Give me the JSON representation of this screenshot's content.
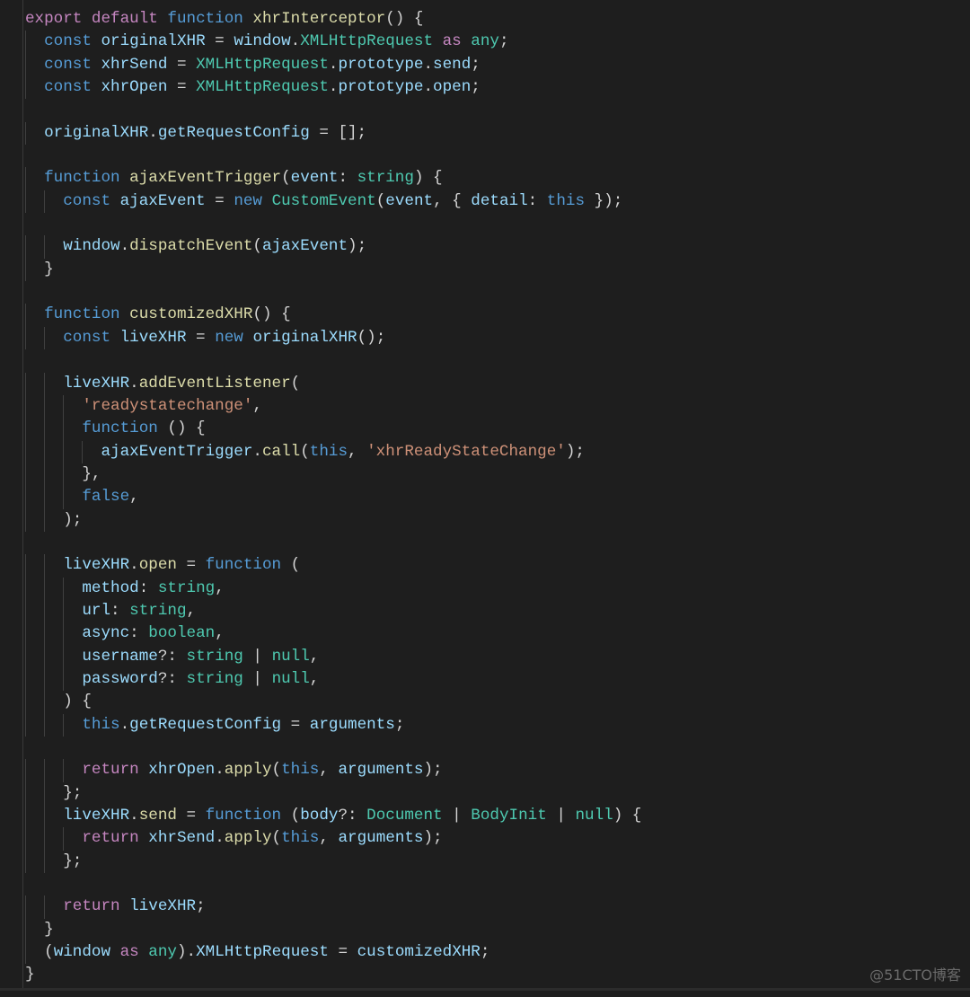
{
  "colors": {
    "background": "#1e1e1e",
    "keyword_control": "#c586c0",
    "keyword": "#569cd6",
    "variable": "#9cdcfe",
    "function": "#dcdcaa",
    "type": "#4ec9b0",
    "string": "#ce9178",
    "punctuation": "#d4d4d4"
  },
  "watermark": "@51CTO博客",
  "lines": [
    [
      [
        "k",
        "export"
      ],
      [
        "p",
        " "
      ],
      [
        "k",
        "default"
      ],
      [
        "p",
        " "
      ],
      [
        "b",
        "function"
      ],
      [
        "p",
        " "
      ],
      [
        "f",
        "xhrInterceptor"
      ],
      [
        "p",
        "() {"
      ]
    ],
    [
      [
        "p",
        "  "
      ],
      [
        "b",
        "const"
      ],
      [
        "p",
        " "
      ],
      [
        "v",
        "originalXHR"
      ],
      [
        "p",
        " = "
      ],
      [
        "v",
        "window"
      ],
      [
        "p",
        "."
      ],
      [
        "t",
        "XMLHttpRequest"
      ],
      [
        "p",
        " "
      ],
      [
        "k",
        "as"
      ],
      [
        "p",
        " "
      ],
      [
        "t",
        "any"
      ],
      [
        "p",
        ";"
      ]
    ],
    [
      [
        "p",
        "  "
      ],
      [
        "b",
        "const"
      ],
      [
        "p",
        " "
      ],
      [
        "v",
        "xhrSend"
      ],
      [
        "p",
        " = "
      ],
      [
        "t",
        "XMLHttpRequest"
      ],
      [
        "p",
        "."
      ],
      [
        "v",
        "prototype"
      ],
      [
        "p",
        "."
      ],
      [
        "v",
        "send"
      ],
      [
        "p",
        ";"
      ]
    ],
    [
      [
        "p",
        "  "
      ],
      [
        "b",
        "const"
      ],
      [
        "p",
        " "
      ],
      [
        "v",
        "xhrOpen"
      ],
      [
        "p",
        " = "
      ],
      [
        "t",
        "XMLHttpRequest"
      ],
      [
        "p",
        "."
      ],
      [
        "v",
        "prototype"
      ],
      [
        "p",
        "."
      ],
      [
        "v",
        "open"
      ],
      [
        "p",
        ";"
      ]
    ],
    [],
    [
      [
        "p",
        "  "
      ],
      [
        "v",
        "originalXHR"
      ],
      [
        "p",
        "."
      ],
      [
        "v",
        "getRequestConfig"
      ],
      [
        "p",
        " = [];"
      ]
    ],
    [],
    [
      [
        "p",
        "  "
      ],
      [
        "b",
        "function"
      ],
      [
        "p",
        " "
      ],
      [
        "f",
        "ajaxEventTrigger"
      ],
      [
        "p",
        "("
      ],
      [
        "v",
        "event"
      ],
      [
        "p",
        ": "
      ],
      [
        "t",
        "string"
      ],
      [
        "p",
        ") {"
      ]
    ],
    [
      [
        "p",
        "    "
      ],
      [
        "b",
        "const"
      ],
      [
        "p",
        " "
      ],
      [
        "v",
        "ajaxEvent"
      ],
      [
        "p",
        " = "
      ],
      [
        "b",
        "new"
      ],
      [
        "p",
        " "
      ],
      [
        "t",
        "CustomEvent"
      ],
      [
        "p",
        "("
      ],
      [
        "v",
        "event"
      ],
      [
        "p",
        ", { "
      ],
      [
        "v",
        "detail"
      ],
      [
        "p",
        ": "
      ],
      [
        "b",
        "this"
      ],
      [
        "p",
        " });"
      ]
    ],
    [],
    [
      [
        "p",
        "    "
      ],
      [
        "v",
        "window"
      ],
      [
        "p",
        "."
      ],
      [
        "f",
        "dispatchEvent"
      ],
      [
        "p",
        "("
      ],
      [
        "v",
        "ajaxEvent"
      ],
      [
        "p",
        ");"
      ]
    ],
    [
      [
        "p",
        "  }"
      ]
    ],
    [],
    [
      [
        "p",
        "  "
      ],
      [
        "b",
        "function"
      ],
      [
        "p",
        " "
      ],
      [
        "f",
        "customizedXHR"
      ],
      [
        "p",
        "() {"
      ]
    ],
    [
      [
        "p",
        "    "
      ],
      [
        "b",
        "const"
      ],
      [
        "p",
        " "
      ],
      [
        "v",
        "liveXHR"
      ],
      [
        "p",
        " = "
      ],
      [
        "b",
        "new"
      ],
      [
        "p",
        " "
      ],
      [
        "v",
        "originalXHR"
      ],
      [
        "p",
        "();"
      ]
    ],
    [],
    [
      [
        "p",
        "    "
      ],
      [
        "v",
        "liveXHR"
      ],
      [
        "p",
        "."
      ],
      [
        "f",
        "addEventListener"
      ],
      [
        "p",
        "("
      ]
    ],
    [
      [
        "p",
        "      "
      ],
      [
        "s",
        "'readystatechange'"
      ],
      [
        "p",
        ","
      ]
    ],
    [
      [
        "p",
        "      "
      ],
      [
        "b",
        "function"
      ],
      [
        "p",
        " () {"
      ]
    ],
    [
      [
        "p",
        "        "
      ],
      [
        "v",
        "ajaxEventTrigger"
      ],
      [
        "p",
        "."
      ],
      [
        "f",
        "call"
      ],
      [
        "p",
        "("
      ],
      [
        "b",
        "this"
      ],
      [
        "p",
        ", "
      ],
      [
        "s",
        "'xhrReadyStateChange'"
      ],
      [
        "p",
        ");"
      ]
    ],
    [
      [
        "p",
        "      },"
      ]
    ],
    [
      [
        "p",
        "      "
      ],
      [
        "b",
        "false"
      ],
      [
        "p",
        ","
      ]
    ],
    [
      [
        "p",
        "    );"
      ]
    ],
    [],
    [
      [
        "p",
        "    "
      ],
      [
        "v",
        "liveXHR"
      ],
      [
        "p",
        "."
      ],
      [
        "f",
        "open"
      ],
      [
        "p",
        " = "
      ],
      [
        "b",
        "function"
      ],
      [
        "p",
        " ("
      ]
    ],
    [
      [
        "p",
        "      "
      ],
      [
        "v",
        "method"
      ],
      [
        "p",
        ": "
      ],
      [
        "t",
        "string"
      ],
      [
        "p",
        ","
      ]
    ],
    [
      [
        "p",
        "      "
      ],
      [
        "v",
        "url"
      ],
      [
        "p",
        ": "
      ],
      [
        "t",
        "string"
      ],
      [
        "p",
        ","
      ]
    ],
    [
      [
        "p",
        "      "
      ],
      [
        "v",
        "async"
      ],
      [
        "p",
        ": "
      ],
      [
        "t",
        "boolean"
      ],
      [
        "p",
        ","
      ]
    ],
    [
      [
        "p",
        "      "
      ],
      [
        "v",
        "username"
      ],
      [
        "p",
        "?: "
      ],
      [
        "t",
        "string"
      ],
      [
        "p",
        " | "
      ],
      [
        "t",
        "null"
      ],
      [
        "p",
        ","
      ]
    ],
    [
      [
        "p",
        "      "
      ],
      [
        "v",
        "password"
      ],
      [
        "p",
        "?: "
      ],
      [
        "t",
        "string"
      ],
      [
        "p",
        " | "
      ],
      [
        "t",
        "null"
      ],
      [
        "p",
        ","
      ]
    ],
    [
      [
        "p",
        "    ) {"
      ]
    ],
    [
      [
        "p",
        "      "
      ],
      [
        "b",
        "this"
      ],
      [
        "p",
        "."
      ],
      [
        "v",
        "getRequestConfig"
      ],
      [
        "p",
        " = "
      ],
      [
        "v",
        "arguments"
      ],
      [
        "p",
        ";"
      ]
    ],
    [],
    [
      [
        "p",
        "      "
      ],
      [
        "k",
        "return"
      ],
      [
        "p",
        " "
      ],
      [
        "v",
        "xhrOpen"
      ],
      [
        "p",
        "."
      ],
      [
        "f",
        "apply"
      ],
      [
        "p",
        "("
      ],
      [
        "b",
        "this"
      ],
      [
        "p",
        ", "
      ],
      [
        "v",
        "arguments"
      ],
      [
        "p",
        ");"
      ]
    ],
    [
      [
        "p",
        "    };"
      ]
    ],
    [
      [
        "p",
        "    "
      ],
      [
        "v",
        "liveXHR"
      ],
      [
        "p",
        "."
      ],
      [
        "f",
        "send"
      ],
      [
        "p",
        " = "
      ],
      [
        "b",
        "function"
      ],
      [
        "p",
        " ("
      ],
      [
        "v",
        "body"
      ],
      [
        "p",
        "?: "
      ],
      [
        "t",
        "Document"
      ],
      [
        "p",
        " | "
      ],
      [
        "t",
        "BodyInit"
      ],
      [
        "p",
        " | "
      ],
      [
        "t",
        "null"
      ],
      [
        "p",
        ") {"
      ]
    ],
    [
      [
        "p",
        "      "
      ],
      [
        "k",
        "return"
      ],
      [
        "p",
        " "
      ],
      [
        "v",
        "xhrSend"
      ],
      [
        "p",
        "."
      ],
      [
        "f",
        "apply"
      ],
      [
        "p",
        "("
      ],
      [
        "b",
        "this"
      ],
      [
        "p",
        ", "
      ],
      [
        "v",
        "arguments"
      ],
      [
        "p",
        ");"
      ]
    ],
    [
      [
        "p",
        "    };"
      ]
    ],
    [],
    [
      [
        "p",
        "    "
      ],
      [
        "k",
        "return"
      ],
      [
        "p",
        " "
      ],
      [
        "v",
        "liveXHR"
      ],
      [
        "p",
        ";"
      ]
    ],
    [
      [
        "p",
        "  }"
      ]
    ],
    [
      [
        "p",
        "  ("
      ],
      [
        "v",
        "window"
      ],
      [
        "p",
        " "
      ],
      [
        "k",
        "as"
      ],
      [
        "p",
        " "
      ],
      [
        "t",
        "any"
      ],
      [
        "p",
        ")."
      ],
      [
        "v",
        "XMLHttpRequest"
      ],
      [
        "p",
        " = "
      ],
      [
        "v",
        "customizedXHR"
      ],
      [
        "p",
        ";"
      ]
    ],
    [
      [
        "p",
        "}"
      ]
    ]
  ]
}
